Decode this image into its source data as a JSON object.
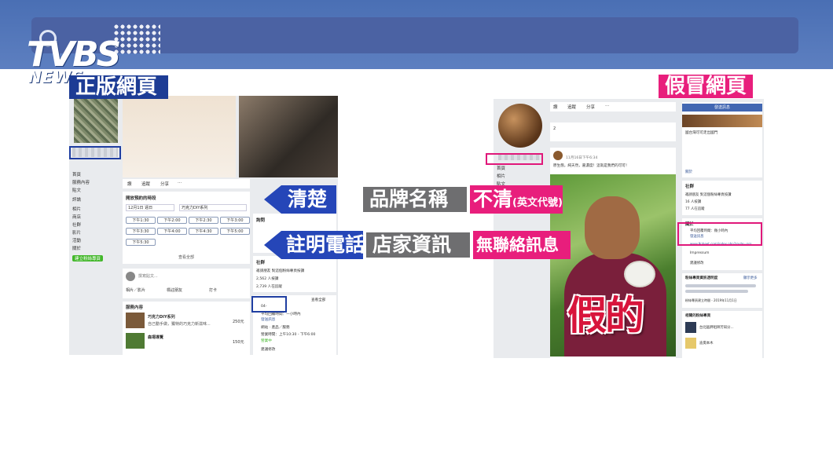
{
  "header": {
    "logo_main": "TVBS",
    "logo_sub": "NEWS"
  },
  "labels": {
    "genuine": "正版網頁",
    "fake": "假冒網頁",
    "fake_stamp": "假的"
  },
  "comparison": {
    "row1": {
      "left": "清楚",
      "middle": "品牌名稱",
      "right": "不清",
      "right_note": "(英文代號)"
    },
    "row2": {
      "left": "註明電話",
      "middle": "店家資訊",
      "right": "無聯絡訊息"
    }
  },
  "genuine_page": {
    "sidebar": [
      "首頁",
      "服務內容",
      "貼文",
      "評論",
      "相片",
      "商店",
      "社群",
      "影片",
      "活動",
      "關於"
    ],
    "sidebar_button": "建立粉絲專頁",
    "action_buttons": [
      "讚",
      "追蹤",
      "分享",
      "···"
    ],
    "booking_title": "開放預約的時段",
    "booking_date": "12月1日 週日",
    "booking_product": "巧克力DIY系列",
    "slots": [
      "下午1:30",
      "下午2:00",
      "下午2:30",
      "下午3:00",
      "下午3:30",
      "下午4:00",
      "下午4:30",
      "下午5:00",
      "下午5:30"
    ],
    "see_all": "查看全部",
    "post_placeholder": "撰寫貼文...",
    "post_actions": [
      "相片／影片",
      "標註朋友",
      "打卡"
    ],
    "services_title": "服務內容",
    "services": [
      {
        "name": "巧克力DIY系列",
        "desc": "自己動手做，獨特的巧克力新滋味...",
        "price": "250元"
      },
      {
        "name": "森場導覽",
        "desc": "",
        "price": "150元"
      }
    ],
    "community_title": "社群",
    "community": [
      "邀請朋友 對這個粉絲專頁按讚",
      "2,562 人按讚",
      "2,739 人在追蹤"
    ],
    "info_title": "查看全部",
    "info": [
      "04-",
      "平均回覆時間：一小時內",
      "發送訊息",
      "網站 · 產品／服務",
      "營業時間：上午10:30 - 下午6:00",
      "營業中",
      "建議修改"
    ],
    "ask_title": "詢問"
  },
  "fake_page": {
    "sidebar": [
      "首頁",
      "相片",
      "貼文"
    ],
    "action_buttons": [
      "讚",
      "追蹤",
      "分享",
      "···"
    ],
    "reactions": "2",
    "post_date": "11月16日下午6:34",
    "post_text": "原生態，純天然，嘉濃度！這就是我們的可可！",
    "send_message": "發送訊息",
    "about_blurb": [
      "國台灣可可走出國門",
      "關於"
    ],
    "community_title": "社群",
    "community": [
      "邀請朋友 對這個粉絲專頁按讚",
      "16 人按讚",
      "77 人在追蹤"
    ],
    "about_title": "關於",
    "about": [
      "平均回覆時間：幾小時內",
      "發送訊息",
      "www.9nheet.com/index.php?route=pro",
      "Impressum",
      "建議修改"
    ],
    "transparency_title": "粉絲專頁資訊透明度",
    "transparency_link": "顯示更多",
    "transparency_date": "粉絲專頁建立時間 - 2019年11月1日",
    "related_title": "相關的粉絲專頁",
    "related": [
      "台北艋舺祖師芳知分...",
      "迪奧本木"
    ]
  },
  "colors": {
    "top_band": "#4a6fb4",
    "blue": "#2546b8",
    "gray": "#6e6e70",
    "pink": "#e81e7c",
    "stamp_red": "#d8143b"
  }
}
